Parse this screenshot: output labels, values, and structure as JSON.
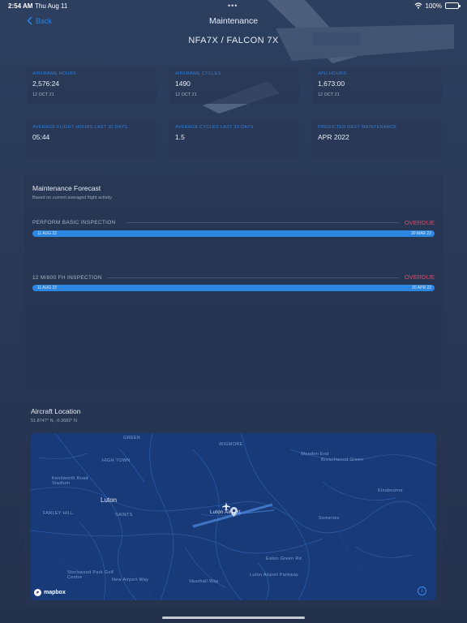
{
  "status_bar": {
    "time": "2:54 AM",
    "date": "Thu Aug 11",
    "battery": "100%",
    "dots": "•••"
  },
  "nav": {
    "back_label": "Back",
    "title": "Maintenance"
  },
  "aircraft": {
    "title": "NFA7X / FALCON 7X"
  },
  "stats": [
    {
      "label": "AIRFRAME HOURS",
      "value": "2,576:24",
      "sub": "12 OCT 21"
    },
    {
      "label": "AIRFRAME CYCLES",
      "value": "1490",
      "sub": "12 OCT 21"
    },
    {
      "label": "APU HOURS",
      "value": "1,673:00",
      "sub": "12 OCT 21"
    },
    {
      "label": "AVERAGE FLIGHT HOURS LAST 30 DAYS",
      "value": "05:44",
      "sub": ""
    },
    {
      "label": "AVERAGE CYCLES LAST 30 DAYS",
      "value": "1.5",
      "sub": ""
    },
    {
      "label": "PREDICTED NEXT MAINTENANCE",
      "value": "APR 2022",
      "sub": ""
    }
  ],
  "forecast": {
    "title": "Maintenance Forecast",
    "subtitle": "Based on current averaged flight activity",
    "items": [
      {
        "label": "PERFORM BASIC INSPECTION",
        "status": "OVERDUE",
        "start": "11 AUG 22",
        "end": "30 MAR 22"
      },
      {
        "label": "12 M/800 FH INSPECTION",
        "status": "OVERDUE",
        "start": "11 AUG 22",
        "end": "20 APR 22"
      }
    ]
  },
  "location": {
    "title": "Aircraft Location",
    "coords": "51.8747° N, -0.3682° N",
    "map": {
      "places": [
        "GREEN",
        "WIGMORE",
        "Wandon End",
        "HIGH TOWN",
        "Kenilworth Road Stadium",
        "Luton",
        "FARLEY HILL",
        "SAINTS",
        "Luton Airport",
        "Someries",
        "Stockwood Park Golf Centre",
        "Breachwood Green",
        "Kinsbourne",
        "Luton Airport Parkway",
        "New Airport Way",
        "Eaton Green Rd",
        "Vauxhall Way"
      ],
      "brand": "mapbox",
      "info": "i"
    }
  }
}
